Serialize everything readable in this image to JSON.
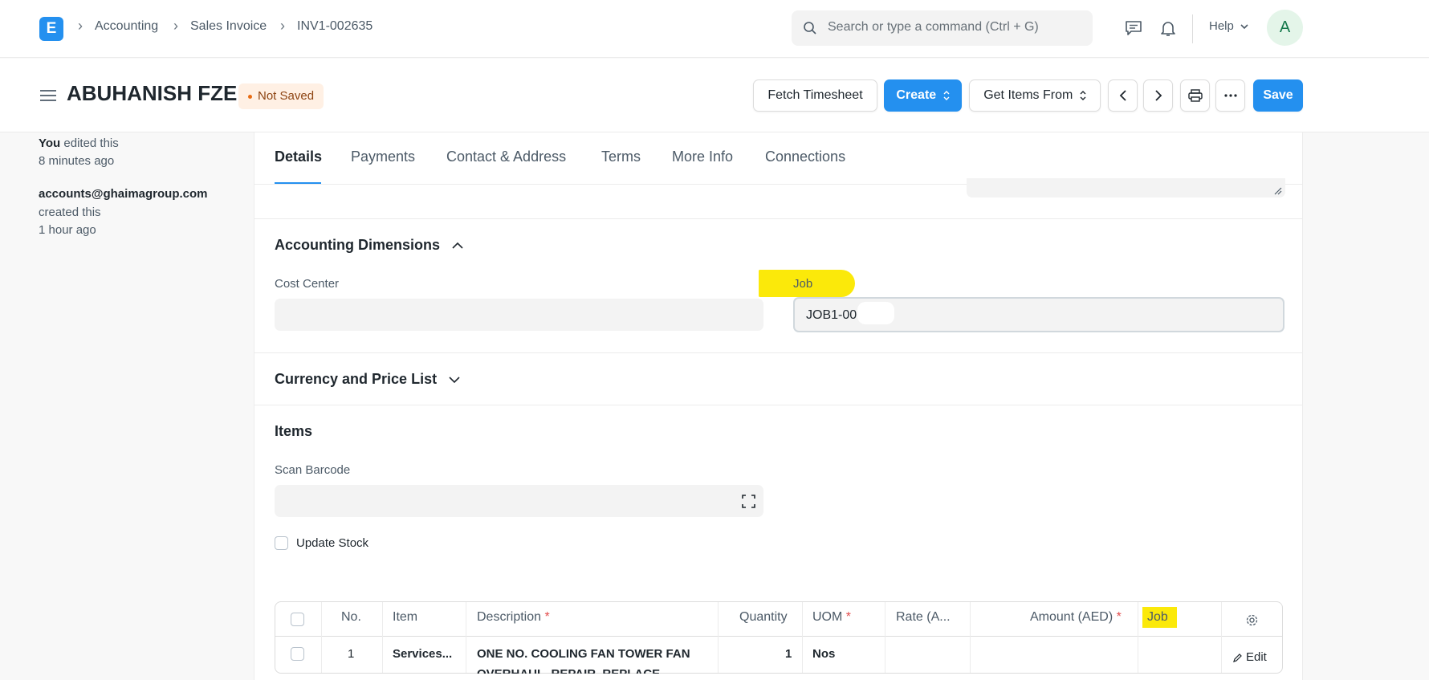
{
  "navbar": {
    "logo_letter": "E",
    "breadcrumbs": [
      "Accounting",
      "Sales Invoice",
      "INV1-002635"
    ],
    "search_placeholder": "Search or type a command (Ctrl + G)",
    "help_label": "Help",
    "avatar_letter": "A",
    "icons": [
      "chat-icon",
      "bell-icon",
      "chevron-down-icon"
    ]
  },
  "page": {
    "title": "ABUHANISH FZE",
    "status": "Not Saved",
    "buttons": {
      "fetch_timesheet": "Fetch Timesheet",
      "create": "Create",
      "get_items_from": "Get Items From",
      "save": "Save"
    }
  },
  "sidebar": {
    "activity": [
      {
        "who": "You",
        "action": "edited this",
        "when": "8 minutes ago"
      },
      {
        "who": "accounts@ghaimagroup.com",
        "action": "created this",
        "when": "1 hour ago"
      }
    ]
  },
  "tabs": [
    "Details",
    "Payments",
    "Contact & Address",
    "Terms",
    "More Info",
    "Connections"
  ],
  "sections": {
    "accounting_dimensions": {
      "title": "Accounting Dimensions",
      "cost_center_label": "Cost Center",
      "cost_center_value": "",
      "job_label": "Job",
      "job_value": "JOB1-00"
    },
    "currency": {
      "title": "Currency and Price List"
    },
    "items": {
      "title": "Items",
      "scan_barcode_label": "Scan Barcode",
      "update_stock_label": "Update Stock",
      "update_stock_checked": false
    }
  },
  "items_table": {
    "columns": [
      "No.",
      "Item",
      "Description",
      "Quantity",
      "UOM",
      "Rate (A...",
      "Amount (AED)",
      "Job"
    ],
    "required_marker": "*",
    "rows": [
      {
        "no": "1",
        "item": "Services...",
        "description": "ONE NO. COOLING FAN TOWER FAN",
        "description_line2": "OVERHAUL, REPAIR, REPLACE",
        "quantity": "1",
        "uom": "Nos",
        "rate": "",
        "amount": "",
        "job": "",
        "edit_label": "Edit"
      }
    ]
  },
  "colors": {
    "primary": "#2490ef",
    "highlight": "#fbe90a",
    "status_bg": "#fff0e4",
    "status_text": "#8d4311"
  }
}
